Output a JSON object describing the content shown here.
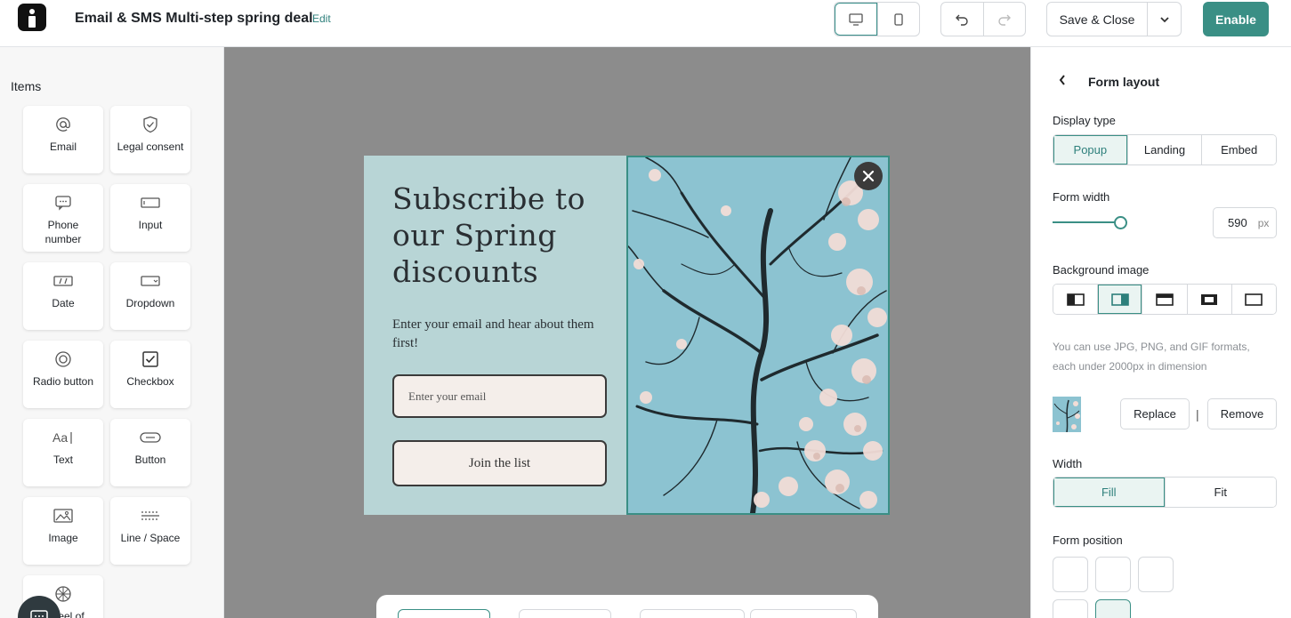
{
  "header": {
    "title": "Email & SMS Multi-step spring deal",
    "edit_label": "Edit",
    "save_close_label": "Save & Close",
    "enable_label": "Enable",
    "accent_color": "#3a8f85"
  },
  "sidebar": {
    "title": "Items",
    "items": [
      {
        "label": "Email",
        "icon": "at-icon"
      },
      {
        "label": "Legal consent",
        "icon": "shield-check-icon"
      },
      {
        "label": "Phone number",
        "icon": "chat-icon"
      },
      {
        "label": "Input",
        "icon": "input-icon"
      },
      {
        "label": "Date",
        "icon": "date-icon"
      },
      {
        "label": "Dropdown",
        "icon": "dropdown-icon"
      },
      {
        "label": "Radio button",
        "icon": "radio-icon"
      },
      {
        "label": "Checkbox",
        "icon": "checkbox-icon"
      },
      {
        "label": "Text",
        "icon": "text-icon"
      },
      {
        "label": "Button",
        "icon": "button-icon"
      },
      {
        "label": "Image",
        "icon": "image-icon"
      },
      {
        "label": "Line / Space",
        "icon": "line-space-icon"
      },
      {
        "label": "Wheel of",
        "icon": "wheel-icon"
      }
    ]
  },
  "popup": {
    "heading": "Subscribe to our Spring discounts",
    "subtext": "Enter your email and hear about them first!",
    "email_placeholder": "Enter your email",
    "button_label": "Join the list",
    "background_color": "#b8d5d6"
  },
  "panel": {
    "title": "Form layout",
    "display_type_label": "Display type",
    "display_types": [
      "Popup",
      "Landing",
      "Embed"
    ],
    "display_type_selected": "Popup",
    "form_width_label": "Form width",
    "form_width_value": "590",
    "form_width_unit": "px",
    "background_image_label": "Background image",
    "background_image_options": [
      "image-left",
      "image-right",
      "image-top-bottom",
      "image-fill-frame",
      "no-image"
    ],
    "background_image_selected": "image-right",
    "hint": "You can use JPG, PNG, and GIF formats, each under 2000px in dimension",
    "replace_label": "Replace",
    "separator": "|",
    "remove_label": "Remove",
    "width_label": "Width",
    "width_options": [
      "Fill",
      "Fit"
    ],
    "width_selected": "Fill",
    "form_position_label": "Form position"
  }
}
